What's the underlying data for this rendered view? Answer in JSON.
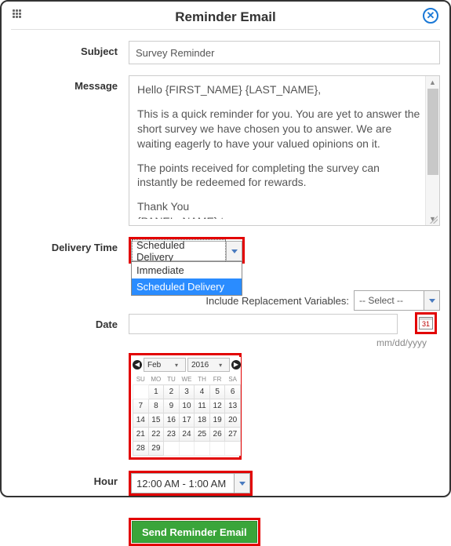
{
  "header": {
    "title": "Reminder Email"
  },
  "labels": {
    "subject": "Subject",
    "message": "Message",
    "delivery_time": "Delivery Time",
    "date": "Date",
    "hour": "Hour",
    "replacement": "Include Replacement Variables:"
  },
  "subject": {
    "value": "Survey Reminder"
  },
  "message": {
    "p1": "Hello {FIRST_NAME} {LAST_NAME},",
    "p2": "This is a quick reminder for you. You are yet to answer the short survey we have chosen you to answer. We are waiting eagerly to have your valued opinions on it.",
    "p3": "The points received for completing the survey can instantly be redeemed for rewards.",
    "p4a": "Thank You",
    "p4b": "{PANEL_NAME} team"
  },
  "delivery": {
    "selected": "Scheduled Delivery",
    "options": {
      "0": "Immediate",
      "1": "Scheduled Delivery"
    }
  },
  "replacement": {
    "selected": "-- Select --"
  },
  "date": {
    "value": "",
    "hint": "mm/dd/yyyy",
    "cal_icon_num": "31"
  },
  "datepicker": {
    "month": "Feb",
    "year": "2016",
    "dow": {
      "0": "SU",
      "1": "MO",
      "2": "TU",
      "3": "WE",
      "4": "TH",
      "5": "FR",
      "6": "SA"
    },
    "cells": {
      "r0": {
        "0": "",
        "1": "1",
        "2": "2",
        "3": "3",
        "4": "4",
        "5": "5",
        "6": "6"
      },
      "r1": {
        "0": "7",
        "1": "8",
        "2": "9",
        "3": "10",
        "4": "11",
        "5": "12",
        "6": "13"
      },
      "r2": {
        "0": "14",
        "1": "15",
        "2": "16",
        "3": "17",
        "4": "18",
        "5": "19",
        "6": "20"
      },
      "r3": {
        "0": "21",
        "1": "22",
        "2": "23",
        "3": "24",
        "4": "25",
        "6": "27",
        "5": "26"
      },
      "r4": {
        "0": "28",
        "1": "29",
        "2": "",
        "3": "",
        "4": "",
        "5": "",
        "6": ""
      }
    }
  },
  "hour": {
    "selected": "12:00 AM - 1:00 AM"
  },
  "actions": {
    "send": "Send Reminder Email"
  }
}
